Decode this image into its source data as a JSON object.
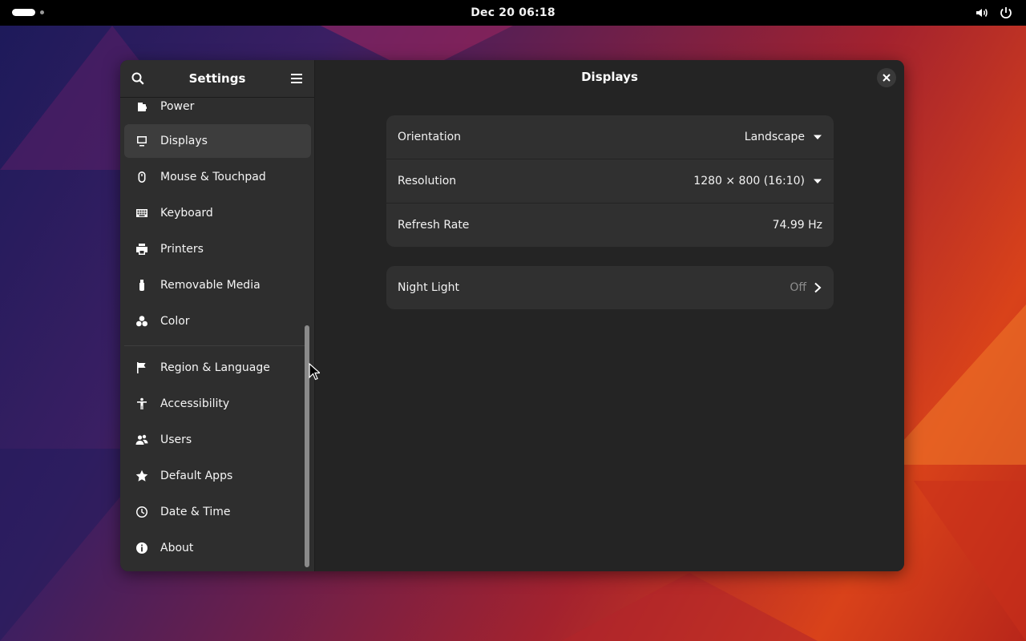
{
  "topbar": {
    "clock": "Dec 20  06:18"
  },
  "window": {
    "sidebar_title": "Settings",
    "content_title": "Displays",
    "sidebar_items": [
      {
        "label": "Power",
        "icon": "power-icon"
      },
      {
        "label": "Displays",
        "icon": "display-icon",
        "selected": true
      },
      {
        "label": "Mouse & Touchpad",
        "icon": "mouse-icon"
      },
      {
        "label": "Keyboard",
        "icon": "keyboard-icon"
      },
      {
        "label": "Printers",
        "icon": "printer-icon"
      },
      {
        "label": "Removable Media",
        "icon": "usb-icon"
      },
      {
        "label": "Color",
        "icon": "color-icon"
      },
      {
        "label": "Region & Language",
        "icon": "flag-icon"
      },
      {
        "label": "Accessibility",
        "icon": "accessibility-icon"
      },
      {
        "label": "Users",
        "icon": "users-icon"
      },
      {
        "label": "Default Apps",
        "icon": "star-icon"
      },
      {
        "label": "Date & Time",
        "icon": "clock-icon"
      },
      {
        "label": "About",
        "icon": "info-icon"
      }
    ],
    "display_settings": {
      "orientation": {
        "label": "Orientation",
        "value": "Landscape"
      },
      "resolution": {
        "label": "Resolution",
        "value": "1280 × 800 (16:10)"
      },
      "refresh_rate": {
        "label": "Refresh Rate",
        "value": "74.99 Hz"
      }
    },
    "night_light": {
      "label": "Night Light",
      "value": "Off"
    }
  },
  "colors": {
    "window_bg": "#242424",
    "sidebar_bg": "#2e2e2e",
    "card_bg": "#303030",
    "selected_item": "#3d3d3d"
  }
}
